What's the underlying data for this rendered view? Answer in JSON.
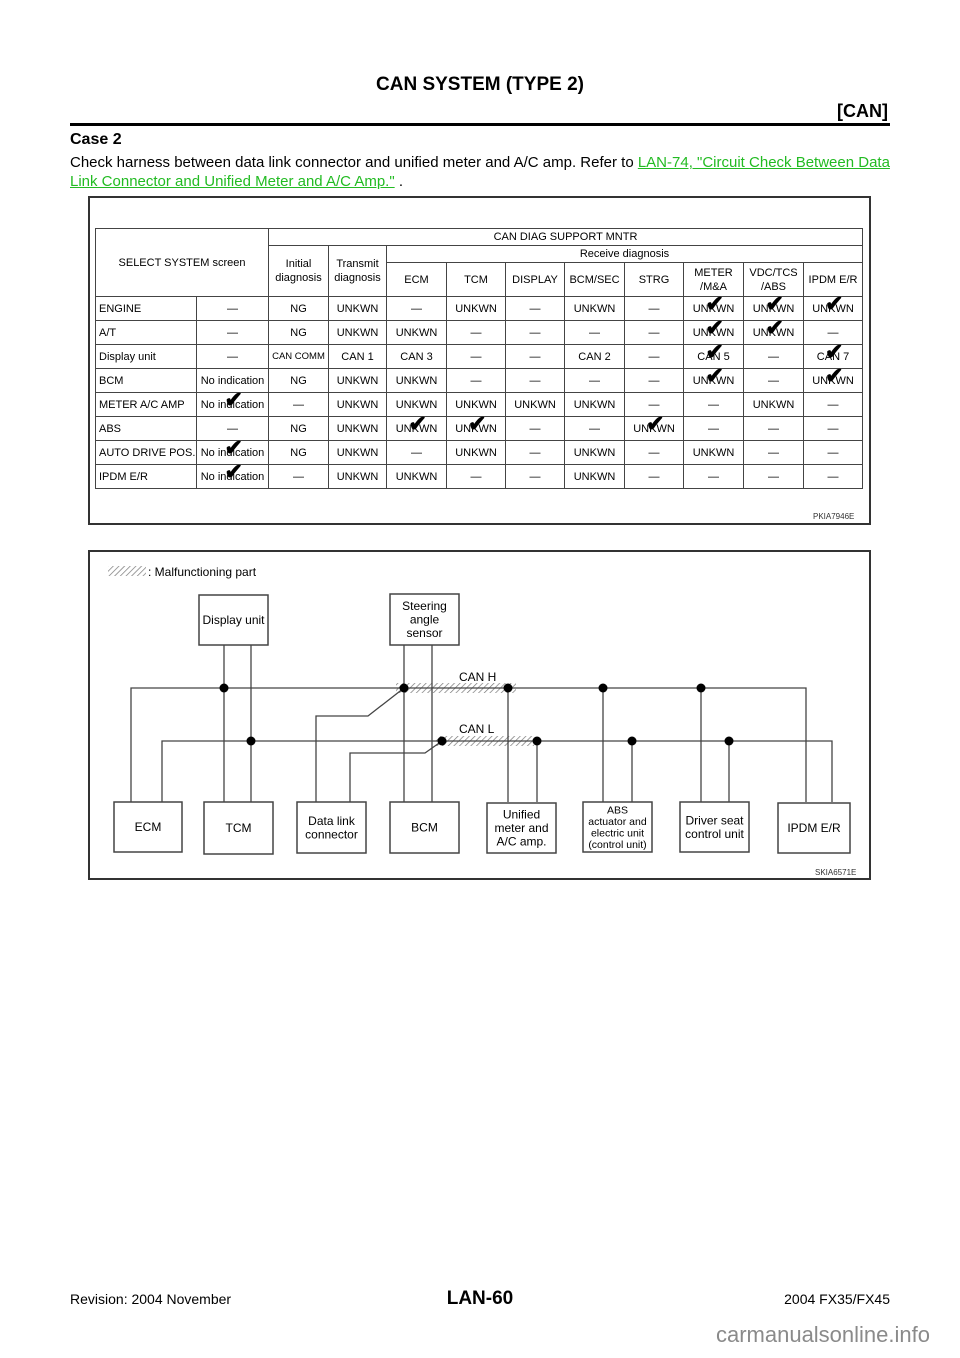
{
  "header": {
    "title": "CAN SYSTEM (TYPE 2)",
    "section_tag": "[CAN]"
  },
  "case": {
    "title": "Case 2",
    "text_before_link": "Check harness between data link connector and unified meter and A/C amp. Refer to ",
    "link_text": "LAN-74, \"Circuit Check Between Data Link Connector and Unified Meter and A/C Amp.\"",
    "text_after_link": " ."
  },
  "figure1": {
    "code": "PKIA7946E",
    "headers": {
      "select_system": "SELECT SYSTEM screen",
      "can_diag": "CAN DIAG SUPPORT MNTR",
      "initial": "Initial diagnosis",
      "transmit": "Transmit diagnosis",
      "receive": "Receive diagnosis",
      "receive_cols": [
        "ECM",
        "TCM",
        "DISPLAY",
        "BCM/SEC",
        "STRG",
        "METER /M&A",
        "VDC/TCS /ABS",
        "IPDM E/R"
      ]
    },
    "rows": [
      {
        "system": "ENGINE",
        "indication": "—",
        "initial": "NG",
        "transmit": "UNKWN",
        "receive": [
          "—",
          "UNKWN",
          "—",
          "UNKWN",
          "—",
          "UNKWN",
          "UNKWN",
          "UNKWN"
        ],
        "checks": [
          false,
          false,
          false,
          false,
          false,
          false,
          false,
          false,
          true,
          true,
          true
        ]
      },
      {
        "system": "A/T",
        "indication": "—",
        "initial": "NG",
        "transmit": "UNKWN",
        "receive": [
          "UNKWN",
          "—",
          "—",
          "—",
          "—",
          "UNKWN",
          "UNKWN",
          "—"
        ],
        "checks": [
          false,
          false,
          false,
          false,
          false,
          false,
          false,
          false,
          true,
          true,
          false
        ]
      },
      {
        "system": "Display unit",
        "indication": "—",
        "initial": "CAN COMM",
        "transmit": "CAN 1",
        "receive": [
          "CAN 3",
          "—",
          "—",
          "CAN 2",
          "—",
          "CAN 5",
          "—",
          "CAN 7"
        ],
        "checks": [
          false,
          false,
          false,
          false,
          false,
          false,
          false,
          false,
          true,
          false,
          true
        ]
      },
      {
        "system": "BCM",
        "indication": "No indication",
        "initial": "NG",
        "transmit": "UNKWN",
        "receive": [
          "UNKWN",
          "—",
          "—",
          "—",
          "—",
          "UNKWN",
          "—",
          "UNKWN"
        ],
        "checks": [
          false,
          false,
          false,
          false,
          false,
          false,
          false,
          false,
          true,
          false,
          true
        ]
      },
      {
        "system": "METER A/C AMP",
        "indication": "No indication",
        "initial": "—",
        "transmit": "UNKWN",
        "receive": [
          "UNKWN",
          "UNKWN",
          "UNKWN",
          "UNKWN",
          "—",
          "—",
          "UNKWN",
          "—"
        ],
        "checks": [
          true,
          false,
          false,
          false,
          false,
          false,
          false,
          false,
          false,
          false,
          false
        ]
      },
      {
        "system": "ABS",
        "indication": "—",
        "initial": "NG",
        "transmit": "UNKWN",
        "receive": [
          "UNKWN",
          "UNKWN",
          "—",
          "—",
          "UNKWN",
          "—",
          "—",
          "—"
        ],
        "checks": [
          false,
          false,
          false,
          true,
          true,
          false,
          false,
          true,
          false,
          false,
          false
        ]
      },
      {
        "system": "AUTO DRIVE POS.",
        "indication": "No indication",
        "initial": "NG",
        "transmit": "UNKWN",
        "receive": [
          "—",
          "UNKWN",
          "—",
          "UNKWN",
          "—",
          "UNKWN",
          "—",
          "—"
        ],
        "checks": [
          true,
          false,
          false,
          false,
          false,
          false,
          false,
          false,
          false,
          false,
          false
        ]
      },
      {
        "system": "IPDM E/R",
        "indication": "No indication",
        "initial": "—",
        "transmit": "UNKWN",
        "receive": [
          "UNKWN",
          "—",
          "—",
          "UNKWN",
          "—",
          "—",
          "—",
          "—"
        ],
        "checks": [
          true,
          false,
          false,
          false,
          false,
          false,
          false,
          false,
          false,
          false,
          false
        ]
      }
    ]
  },
  "figure2": {
    "code": "SKIA6571E",
    "legend": ": Malfunctioning part",
    "can_h_label": "CAN H",
    "can_l_label": "CAN L",
    "top_units": [
      {
        "id": "display",
        "lines": [
          "Display unit"
        ]
      },
      {
        "id": "steering",
        "lines": [
          "Steering",
          "angle",
          "sensor"
        ]
      }
    ],
    "bottom_units": [
      {
        "id": "ecm",
        "lines": [
          "ECM"
        ]
      },
      {
        "id": "tcm",
        "lines": [
          "TCM"
        ]
      },
      {
        "id": "dlc",
        "lines": [
          "Data link",
          "connector"
        ]
      },
      {
        "id": "bcm",
        "lines": [
          "BCM"
        ]
      },
      {
        "id": "meter",
        "lines": [
          "Unified",
          "meter and",
          "A/C amp."
        ]
      },
      {
        "id": "abs",
        "lines": [
          "ABS",
          "actuator and",
          "electric unit",
          "(control unit)"
        ]
      },
      {
        "id": "driver-seat",
        "lines": [
          "Driver seat",
          "control unit"
        ]
      },
      {
        "id": "ipdm",
        "lines": [
          "IPDM E/R"
        ]
      }
    ]
  },
  "footer": {
    "revision": "Revision: 2004 November",
    "page": "LAN-60",
    "model": "2004 FX35/FX45",
    "watermark": "carmanualsonline.info"
  },
  "colors": {
    "link": "#22bb22",
    "watermark": "#8a8a8a"
  }
}
